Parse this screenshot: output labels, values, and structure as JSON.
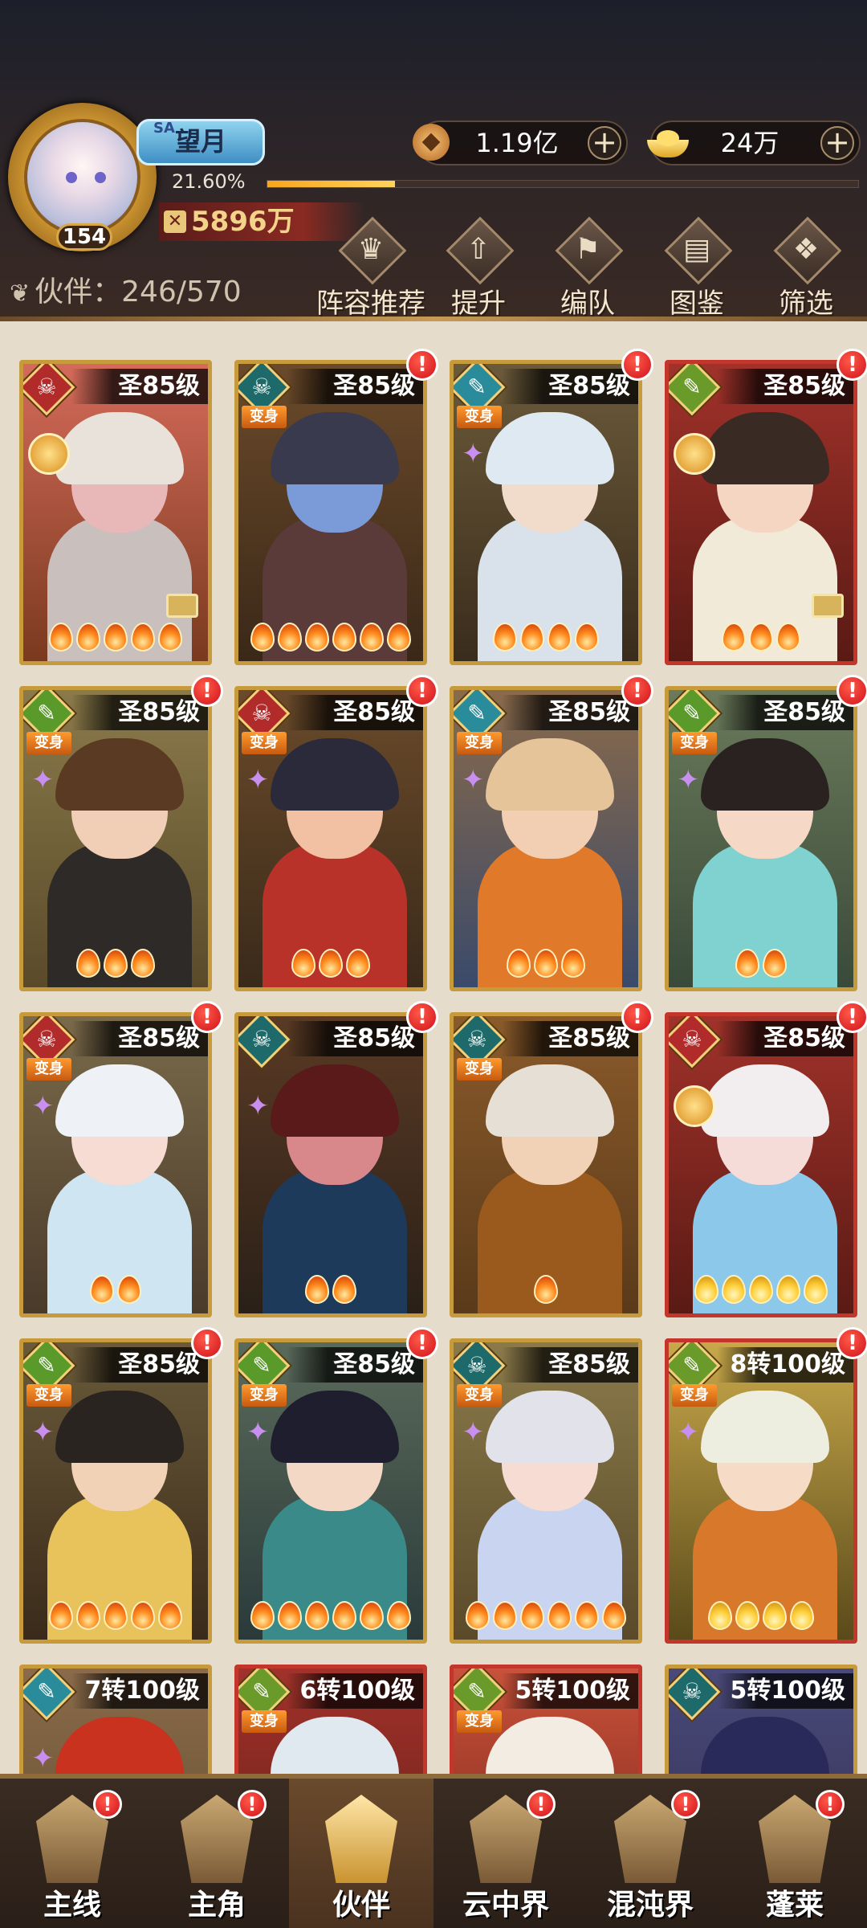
{
  "player": {
    "avatar_level": "154",
    "name_tag": "SA",
    "name": "望月",
    "exp_percent": "21.60%",
    "exp_fraction": 0.216,
    "power": "5896万"
  },
  "currency": {
    "copper": {
      "value": "1.19亿",
      "icon": "coin-icon"
    },
    "gold": {
      "value": "24万",
      "icon": "gold-ingot-icon"
    },
    "plus": "+"
  },
  "companions": {
    "label": "伙伴：246/570"
  },
  "actions": [
    {
      "label": "阵容推荐",
      "glyph": "♛"
    },
    {
      "label": "提升",
      "glyph": "⇧"
    },
    {
      "label": "编队",
      "glyph": "⚑"
    },
    {
      "label": "图鉴",
      "glyph": "▤"
    },
    {
      "label": "筛选",
      "glyph": "❖"
    }
  ],
  "cards": [
    {
      "level": "圣85级",
      "border": "gold",
      "element": "#b22b2b",
      "glyph": "☠",
      "badge": false,
      "bianshen": false,
      "medal": true,
      "spark": false,
      "equip": true,
      "stars": 5,
      "bg": [
        "#7a3a1e",
        "#d46a5a"
      ],
      "hair": "#e8e2da",
      "skin": "#e8b7b7",
      "body": "#c9c0be"
    },
    {
      "level": "圣85级",
      "border": "gold",
      "element": "#1e6a6a",
      "glyph": "☠",
      "badge": true,
      "bianshen": true,
      "medal": false,
      "spark": false,
      "equip": false,
      "stars": 6,
      "bg": [
        "#3a2818",
        "#6b4a2a"
      ],
      "hair": "#3a3a4e",
      "skin": "#7a9ad8",
      "body": "#5b3a3a"
    },
    {
      "level": "圣85级",
      "border": "gold",
      "element": "#2a8c9a",
      "glyph": "✎",
      "badge": true,
      "bianshen": true,
      "medal": false,
      "spark": true,
      "equip": false,
      "stars": 4,
      "bg": [
        "#3a2c1c",
        "#6b5a3a"
      ],
      "hair": "#dfe9f2",
      "skin": "#f1dccb",
      "body": "#d9e2ea"
    },
    {
      "level": "圣85级",
      "border": "red",
      "element": "#6a9a2a",
      "glyph": "✎",
      "badge": true,
      "bianshen": false,
      "medal": true,
      "spark": false,
      "equip": true,
      "stars": 3,
      "bg": [
        "#5a1a14",
        "#a0322a"
      ],
      "hair": "#3a2a24",
      "skin": "#f4d6c2",
      "body": "#f2ead8"
    },
    {
      "level": "圣85级",
      "border": "gold",
      "element": "#5a9a2a",
      "glyph": "✎",
      "badge": true,
      "bianshen": true,
      "medal": false,
      "spark": true,
      "equip": false,
      "stars": 3,
      "bg": [
        "#5a4a2a",
        "#8a7a4a"
      ],
      "hair": "#5a3a22",
      "skin": "#f0cfb6",
      "body": "#2e2a28"
    },
    {
      "level": "圣85级",
      "border": "gold",
      "element": "#b22b2b",
      "glyph": "☠",
      "badge": true,
      "bianshen": true,
      "medal": false,
      "spark": true,
      "equip": false,
      "stars": 3,
      "bg": [
        "#3a2a1a",
        "#6a4a2a"
      ],
      "hair": "#2a2a3a",
      "skin": "#f2c0a2",
      "body": "#b8322a"
    },
    {
      "level": "圣85级",
      "border": "gold",
      "element": "#2a8c9a",
      "glyph": "✎",
      "badge": true,
      "bianshen": true,
      "medal": false,
      "spark": true,
      "equip": false,
      "stars": 3,
      "bg": [
        "#3a4a6a",
        "#8a6a4a"
      ],
      "hair": "#e6c49a",
      "skin": "#f2cfb2",
      "body": "#e07a2a"
    },
    {
      "level": "圣85级",
      "border": "gold",
      "element": "#5a9a2a",
      "glyph": "✎",
      "badge": true,
      "bianshen": true,
      "medal": false,
      "spark": true,
      "equip": false,
      "stars": 2,
      "bg": [
        "#3a4a3a",
        "#6a7a5a"
      ],
      "hair": "#2a2220",
      "skin": "#f6d8c6",
      "body": "#7fd2d0"
    },
    {
      "level": "圣85级",
      "border": "gold",
      "element": "#b22b2b",
      "glyph": "☠",
      "badge": true,
      "bianshen": true,
      "medal": false,
      "spark": true,
      "equip": false,
      "stars": 2,
      "bg": [
        "#4a3a2a",
        "#7a6a4a"
      ],
      "hair": "#eef2f6",
      "skin": "#f6dcd2",
      "body": "#cfe6f2"
    },
    {
      "level": "圣85级",
      "border": "gold",
      "element": "#1e6a6a",
      "glyph": "☠",
      "badge": true,
      "bianshen": false,
      "medal": false,
      "spark": true,
      "equip": false,
      "stars": 2,
      "bg": [
        "#2a2018",
        "#5a3a24"
      ],
      "hair": "#5a1a1a",
      "skin": "#d8878a",
      "body": "#1e3a5a"
    },
    {
      "level": "圣85级",
      "border": "gold",
      "element": "#1e6a6a",
      "glyph": "☠",
      "badge": true,
      "bianshen": true,
      "medal": false,
      "spark": false,
      "equip": false,
      "stars": 1,
      "bg": [
        "#5a3a1a",
        "#8a5a2a"
      ],
      "hair": "#e6dfd6",
      "skin": "#f2d2b6",
      "body": "#9a5a1e"
    },
    {
      "level": "圣85级",
      "border": "red",
      "element": "#b22b2b",
      "glyph": "☠",
      "badge": true,
      "bianshen": false,
      "medal": true,
      "spark": false,
      "equip": false,
      "stars": 5,
      "bg": [
        "#5a1a14",
        "#a0322a"
      ],
      "hair": "#f2eef0",
      "skin": "#f6dcd8",
      "body": "#8cc8ea"
    },
    {
      "level": "圣85级",
      "border": "gold",
      "element": "#5a9a2a",
      "glyph": "✎",
      "badge": true,
      "bianshen": true,
      "medal": false,
      "spark": true,
      "equip": false,
      "stars": 5,
      "bg": [
        "#3a2a1a",
        "#6a5a3a"
      ],
      "hair": "#2a2420",
      "skin": "#f2d2b6",
      "body": "#e8c25a"
    },
    {
      "level": "圣85级",
      "border": "gold",
      "element": "#5a9a2a",
      "glyph": "✎",
      "badge": true,
      "bianshen": true,
      "medal": false,
      "spark": true,
      "equip": false,
      "stars": 6,
      "bg": [
        "#2a3a3a",
        "#5a6a5a"
      ],
      "hair": "#1e1e2e",
      "skin": "#f4d8c6",
      "body": "#3a8a8a"
    },
    {
      "level": "圣85级",
      "border": "gold",
      "element": "#1e6a6a",
      "glyph": "☠",
      "badge": false,
      "bianshen": true,
      "medal": false,
      "spark": true,
      "equip": false,
      "stars": 6,
      "bg": [
        "#5a4a2a",
        "#8a7a4a"
      ],
      "hair": "#e2e2ea",
      "skin": "#f6dcd2",
      "body": "#c8d4f0"
    },
    {
      "level": "8转100级",
      "border": "red",
      "element": "#6a9a2a",
      "glyph": "✎",
      "badge": true,
      "bianshen": true,
      "medal": false,
      "spark": true,
      "equip": false,
      "stars": 4,
      "bg": [
        "#5a4a1a",
        "#c8a84a"
      ],
      "hair": "#eeeee0",
      "skin": "#f6dcc6",
      "body": "#d8782a"
    },
    {
      "level": "7转100级",
      "border": "gold",
      "element": "#2a8c9a",
      "glyph": "✎",
      "badge": false,
      "bianshen": false,
      "medal": false,
      "spark": true,
      "equip": false,
      "stars": 0,
      "bg": [
        "#5a4a2a",
        "#8a6a4a"
      ],
      "hair": "#c8321e",
      "skin": "#f2c0a2",
      "body": "#3a2a2a"
    },
    {
      "level": "6转100级",
      "border": "red",
      "element": "#6a9a2a",
      "glyph": "✎",
      "badge": false,
      "bianshen": true,
      "medal": false,
      "spark": false,
      "equip": false,
      "stars": 0,
      "bg": [
        "#5a1a14",
        "#a0322a"
      ],
      "hair": "#e0e8f0",
      "skin": "#f6dcd2",
      "body": "#8ab0d8"
    },
    {
      "level": "5转100级",
      "border": "red",
      "element": "#6a9a2a",
      "glyph": "✎",
      "badge": false,
      "bianshen": true,
      "medal": false,
      "spark": false,
      "equip": false,
      "stars": 0,
      "bg": [
        "#6a1a14",
        "#c8523a"
      ],
      "hair": "#f2ece2",
      "skin": "#e8b8a0",
      "body": "#8a3a2a"
    },
    {
      "level": "5转100级",
      "border": "gold",
      "element": "#1e6a6a",
      "glyph": "☠",
      "badge": false,
      "bianshen": false,
      "medal": false,
      "spark": false,
      "equip": false,
      "stars": 0,
      "bg": [
        "#2a2a4a",
        "#4a4a7a"
      ],
      "hair": "#2a2a5a",
      "skin": "#c8b8e0",
      "body": "#3a3a6a"
    }
  ],
  "labels": {
    "bianshen": "变身",
    "badge": "!"
  },
  "nav": [
    {
      "label": "主线",
      "badge": "!"
    },
    {
      "label": "主角",
      "badge": "!"
    },
    {
      "label": "伙伴",
      "badge": ""
    },
    {
      "label": "云中界",
      "badge": "!"
    },
    {
      "label": "混沌界",
      "badge": "!"
    },
    {
      "label": "蓬莱",
      "badge": "!"
    }
  ]
}
